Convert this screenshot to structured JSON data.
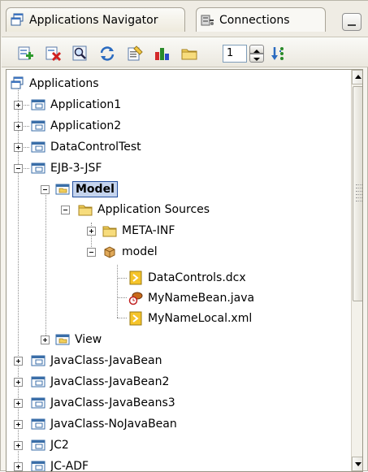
{
  "tabs": [
    {
      "label": "Applications Navigator",
      "icon": "applications-navigator-icon",
      "active": true
    },
    {
      "label": "Connections",
      "icon": "connections-icon",
      "active": false
    }
  ],
  "toolbar": {
    "buttons": [
      {
        "name": "new-application-button",
        "icon": "new-icon"
      },
      {
        "name": "delete-button",
        "icon": "delete-icon"
      },
      {
        "name": "find-button",
        "icon": "find-icon"
      },
      {
        "name": "refresh-button",
        "icon": "refresh-icon"
      },
      {
        "name": "properties-button",
        "icon": "properties-icon"
      },
      {
        "name": "chart-button",
        "icon": "chart-icon"
      },
      {
        "name": "folder-button",
        "icon": "folder-icon"
      }
    ],
    "level_value": "1",
    "sort_icon": "sort-icon"
  },
  "tree": {
    "root": "Applications",
    "items": [
      {
        "label": "Application1"
      },
      {
        "label": "Application2"
      },
      {
        "label": "DataControlTest"
      },
      {
        "label": "EJB-3-JSF"
      },
      {
        "label": "Model"
      },
      {
        "label": "Application Sources"
      },
      {
        "label": "META-INF"
      },
      {
        "label": "model"
      },
      {
        "label": "DataControls.dcx"
      },
      {
        "label": "MyNameBean.java"
      },
      {
        "label": "MyNameLocal.xml"
      },
      {
        "label": "View"
      },
      {
        "label": "JavaClass-JavaBean"
      },
      {
        "label": "JavaClass-JavaBean2"
      },
      {
        "label": "JavaClass-JavaBeans3"
      },
      {
        "label": "JavaClass-NoJavaBean"
      },
      {
        "label": "JC2"
      },
      {
        "label": "JC-ADF"
      }
    ]
  },
  "colors": {
    "selection_bg": "#c5d4ee",
    "selection_border": "#2450a0",
    "folder": "#f2cf5a",
    "project_icon": "#3a6ea8"
  }
}
